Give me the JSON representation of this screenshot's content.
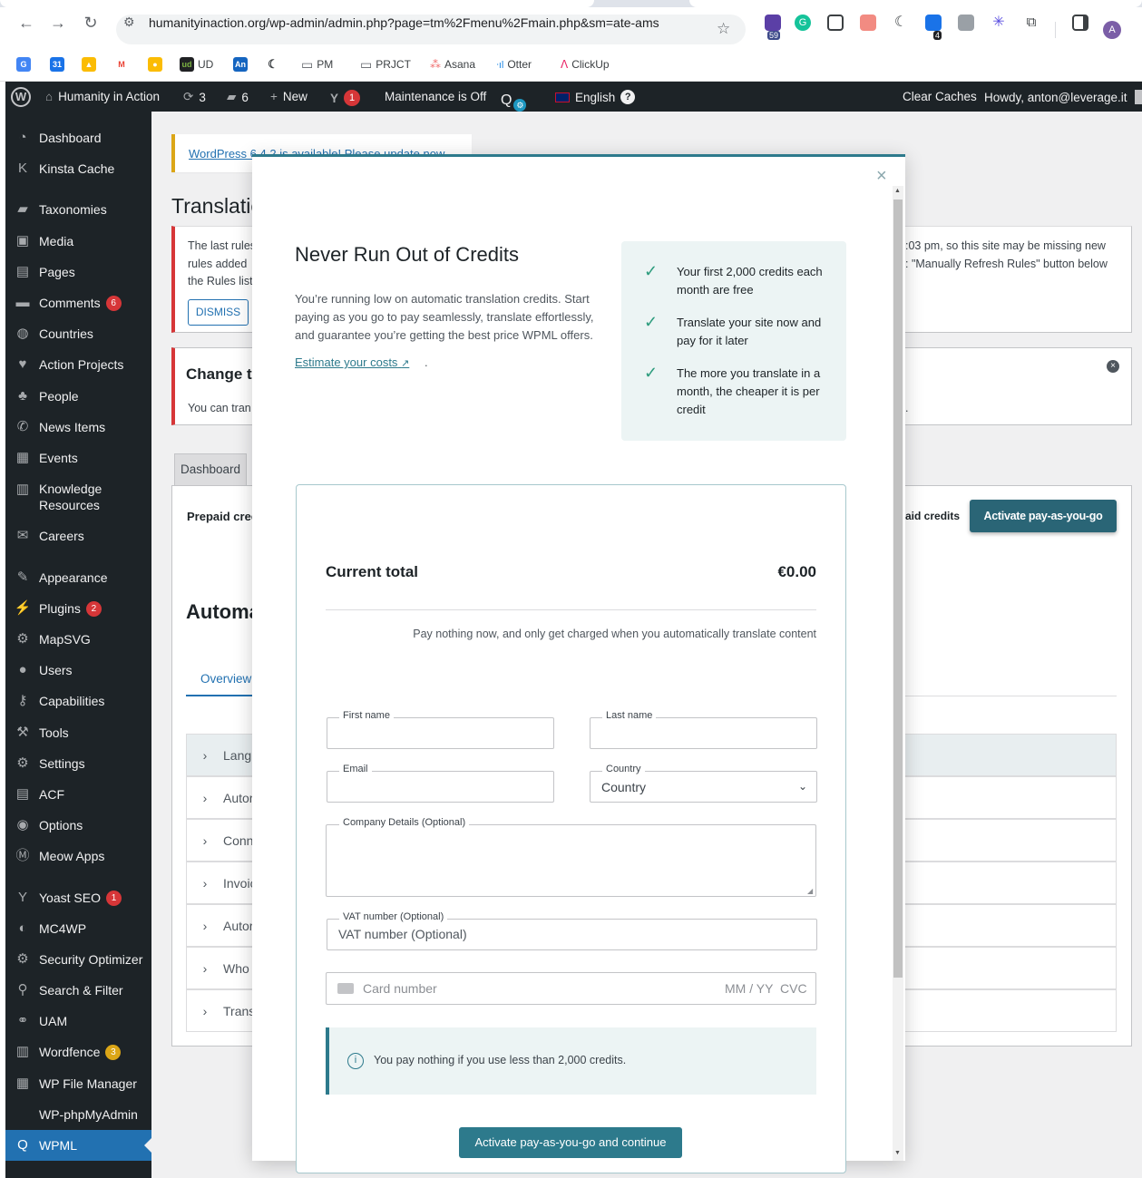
{
  "browser": {
    "url": "humanityinaction.org/wp-admin/admin.php?page=tm%2Fmenu%2Fmain.php&sm=ate-ams",
    "ext_badge_1": "59",
    "ext_badge_2": "4",
    "profile_initial": "A",
    "bookmarks": [
      "UD",
      "An",
      "PM",
      "PRJCT",
      "Asana",
      "Otter",
      "ClickUp"
    ]
  },
  "adminbar": {
    "site_name": "Humanity in Action",
    "updates": "3",
    "comments": "6",
    "new_label": "New",
    "yoast_count": "1",
    "maintenance": "Maintenance is Off",
    "language": "English",
    "clear_caches": "Clear Caches",
    "howdy": "Howdy, anton@leverage.it"
  },
  "sidebar": {
    "items": [
      {
        "label": "Dashboard"
      },
      {
        "label": "Kinsta Cache"
      },
      {
        "label": "Taxonomies"
      },
      {
        "label": "Media"
      },
      {
        "label": "Pages"
      },
      {
        "label": "Comments",
        "badge": "6"
      },
      {
        "label": "Countries"
      },
      {
        "label": "Action Projects"
      },
      {
        "label": "People"
      },
      {
        "label": "News Items"
      },
      {
        "label": "Events"
      },
      {
        "label": "Knowledge Resources"
      },
      {
        "label": "Careers"
      },
      {
        "label": "Appearance"
      },
      {
        "label": "Plugins",
        "badge": "2"
      },
      {
        "label": "MapSVG"
      },
      {
        "label": "Users"
      },
      {
        "label": "Capabilities"
      },
      {
        "label": "Tools"
      },
      {
        "label": "Settings"
      },
      {
        "label": "ACF"
      },
      {
        "label": "Options"
      },
      {
        "label": "Meow Apps"
      },
      {
        "label": "Yoast SEO",
        "badge": "1"
      },
      {
        "label": "MC4WP"
      },
      {
        "label": "Security Optimizer"
      },
      {
        "label": "Search & Filter"
      },
      {
        "label": "UAM"
      },
      {
        "label": "Wordfence",
        "badge": "3"
      },
      {
        "label": "WP File Manager"
      },
      {
        "label": "WP-phpMyAdmin"
      },
      {
        "label": "WPML"
      }
    ]
  },
  "page": {
    "update_notice_link": "WordPress 6.4.2",
    "update_notice_text": " is available! ",
    "update_notice_cta": "Please update now.",
    "title_partial": "Translatic",
    "rules_notice_left": "The last rules",
    "rules_notice_left2": "rules added",
    "rules_notice_left3": "the Rules list",
    "rules_notice_right": ":03 pm, so this site may be missing new",
    "rules_notice_right2": ": \"Manually Refresh Rules\" button below",
    "dismiss": "DISMISS",
    "change_title": "Change th",
    "change_text": "You can tran",
    "dashboard_tab": "Dashboard",
    "prepaid_label": "Prepaid cred",
    "paid_credits": "aid credits",
    "activate_btn": "Activate pay-as-you-go",
    "automatic_title": "Automa",
    "overview_tab": "Overview",
    "rows": [
      "Langu",
      "Autor",
      "Conn",
      "Invoic",
      "Autor",
      "Who",
      "Trans"
    ]
  },
  "modal": {
    "title": "Never Run Out of Credits",
    "description": "You’re running low on automatic translation credits. Start paying as you go to pay seamlessly, translate effortlessly, and guarantee you’re getting the best price WPML offers.",
    "estimate_link": "Estimate your costs",
    "estimate_suffix": ".",
    "benefits": [
      "Your first 2,000 credits each month are free",
      "Translate your site now and pay for it later",
      "The more you translate in a month, the cheaper it is per credit"
    ],
    "current_total_label": "Current total",
    "current_total_value": "€0.00",
    "pay_note": "Pay nothing now, and only get charged when you automatically translate content",
    "first_name_label": "First name",
    "last_name_label": "Last name",
    "email_label": "Email",
    "country_label": "Country",
    "country_value": "Country",
    "company_label": "Company Details (Optional)",
    "vat_label": "VAT number (Optional)",
    "vat_placeholder": "VAT number (Optional)",
    "card_placeholder": "Card number",
    "card_expiry": "MM / YY",
    "card_cvc": "CVC",
    "info_text": "You pay nothing if you use less than 2,000 credits.",
    "submit": "Activate pay-as-you-go and continue"
  },
  "colors": {
    "wp_dark": "#1d2327",
    "wp_blue": "#2271b1",
    "wpml_teal": "#2d7a8c",
    "badge_red": "#d63638"
  }
}
